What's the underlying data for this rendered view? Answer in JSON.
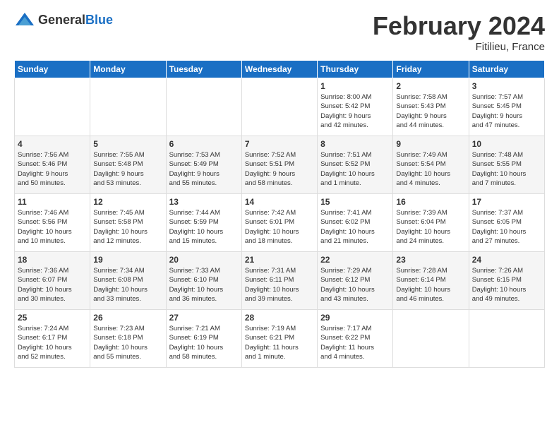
{
  "header": {
    "logo_general": "General",
    "logo_blue": "Blue",
    "month_title": "February 2024",
    "location": "Fitilieu, France"
  },
  "days_of_week": [
    "Sunday",
    "Monday",
    "Tuesday",
    "Wednesday",
    "Thursday",
    "Friday",
    "Saturday"
  ],
  "weeks": [
    [
      {
        "day": "",
        "info": ""
      },
      {
        "day": "",
        "info": ""
      },
      {
        "day": "",
        "info": ""
      },
      {
        "day": "",
        "info": ""
      },
      {
        "day": "1",
        "info": "Sunrise: 8:00 AM\nSunset: 5:42 PM\nDaylight: 9 hours\nand 42 minutes."
      },
      {
        "day": "2",
        "info": "Sunrise: 7:58 AM\nSunset: 5:43 PM\nDaylight: 9 hours\nand 44 minutes."
      },
      {
        "day": "3",
        "info": "Sunrise: 7:57 AM\nSunset: 5:45 PM\nDaylight: 9 hours\nand 47 minutes."
      }
    ],
    [
      {
        "day": "4",
        "info": "Sunrise: 7:56 AM\nSunset: 5:46 PM\nDaylight: 9 hours\nand 50 minutes."
      },
      {
        "day": "5",
        "info": "Sunrise: 7:55 AM\nSunset: 5:48 PM\nDaylight: 9 hours\nand 53 minutes."
      },
      {
        "day": "6",
        "info": "Sunrise: 7:53 AM\nSunset: 5:49 PM\nDaylight: 9 hours\nand 55 minutes."
      },
      {
        "day": "7",
        "info": "Sunrise: 7:52 AM\nSunset: 5:51 PM\nDaylight: 9 hours\nand 58 minutes."
      },
      {
        "day": "8",
        "info": "Sunrise: 7:51 AM\nSunset: 5:52 PM\nDaylight: 10 hours\nand 1 minute."
      },
      {
        "day": "9",
        "info": "Sunrise: 7:49 AM\nSunset: 5:54 PM\nDaylight: 10 hours\nand 4 minutes."
      },
      {
        "day": "10",
        "info": "Sunrise: 7:48 AM\nSunset: 5:55 PM\nDaylight: 10 hours\nand 7 minutes."
      }
    ],
    [
      {
        "day": "11",
        "info": "Sunrise: 7:46 AM\nSunset: 5:56 PM\nDaylight: 10 hours\nand 10 minutes."
      },
      {
        "day": "12",
        "info": "Sunrise: 7:45 AM\nSunset: 5:58 PM\nDaylight: 10 hours\nand 12 minutes."
      },
      {
        "day": "13",
        "info": "Sunrise: 7:44 AM\nSunset: 5:59 PM\nDaylight: 10 hours\nand 15 minutes."
      },
      {
        "day": "14",
        "info": "Sunrise: 7:42 AM\nSunset: 6:01 PM\nDaylight: 10 hours\nand 18 minutes."
      },
      {
        "day": "15",
        "info": "Sunrise: 7:41 AM\nSunset: 6:02 PM\nDaylight: 10 hours\nand 21 minutes."
      },
      {
        "day": "16",
        "info": "Sunrise: 7:39 AM\nSunset: 6:04 PM\nDaylight: 10 hours\nand 24 minutes."
      },
      {
        "day": "17",
        "info": "Sunrise: 7:37 AM\nSunset: 6:05 PM\nDaylight: 10 hours\nand 27 minutes."
      }
    ],
    [
      {
        "day": "18",
        "info": "Sunrise: 7:36 AM\nSunset: 6:07 PM\nDaylight: 10 hours\nand 30 minutes."
      },
      {
        "day": "19",
        "info": "Sunrise: 7:34 AM\nSunset: 6:08 PM\nDaylight: 10 hours\nand 33 minutes."
      },
      {
        "day": "20",
        "info": "Sunrise: 7:33 AM\nSunset: 6:10 PM\nDaylight: 10 hours\nand 36 minutes."
      },
      {
        "day": "21",
        "info": "Sunrise: 7:31 AM\nSunset: 6:11 PM\nDaylight: 10 hours\nand 39 minutes."
      },
      {
        "day": "22",
        "info": "Sunrise: 7:29 AM\nSunset: 6:12 PM\nDaylight: 10 hours\nand 43 minutes."
      },
      {
        "day": "23",
        "info": "Sunrise: 7:28 AM\nSunset: 6:14 PM\nDaylight: 10 hours\nand 46 minutes."
      },
      {
        "day": "24",
        "info": "Sunrise: 7:26 AM\nSunset: 6:15 PM\nDaylight: 10 hours\nand 49 minutes."
      }
    ],
    [
      {
        "day": "25",
        "info": "Sunrise: 7:24 AM\nSunset: 6:17 PM\nDaylight: 10 hours\nand 52 minutes."
      },
      {
        "day": "26",
        "info": "Sunrise: 7:23 AM\nSunset: 6:18 PM\nDaylight: 10 hours\nand 55 minutes."
      },
      {
        "day": "27",
        "info": "Sunrise: 7:21 AM\nSunset: 6:19 PM\nDaylight: 10 hours\nand 58 minutes."
      },
      {
        "day": "28",
        "info": "Sunrise: 7:19 AM\nSunset: 6:21 PM\nDaylight: 11 hours\nand 1 minute."
      },
      {
        "day": "29",
        "info": "Sunrise: 7:17 AM\nSunset: 6:22 PM\nDaylight: 11 hours\nand 4 minutes."
      },
      {
        "day": "",
        "info": ""
      },
      {
        "day": "",
        "info": ""
      }
    ]
  ]
}
